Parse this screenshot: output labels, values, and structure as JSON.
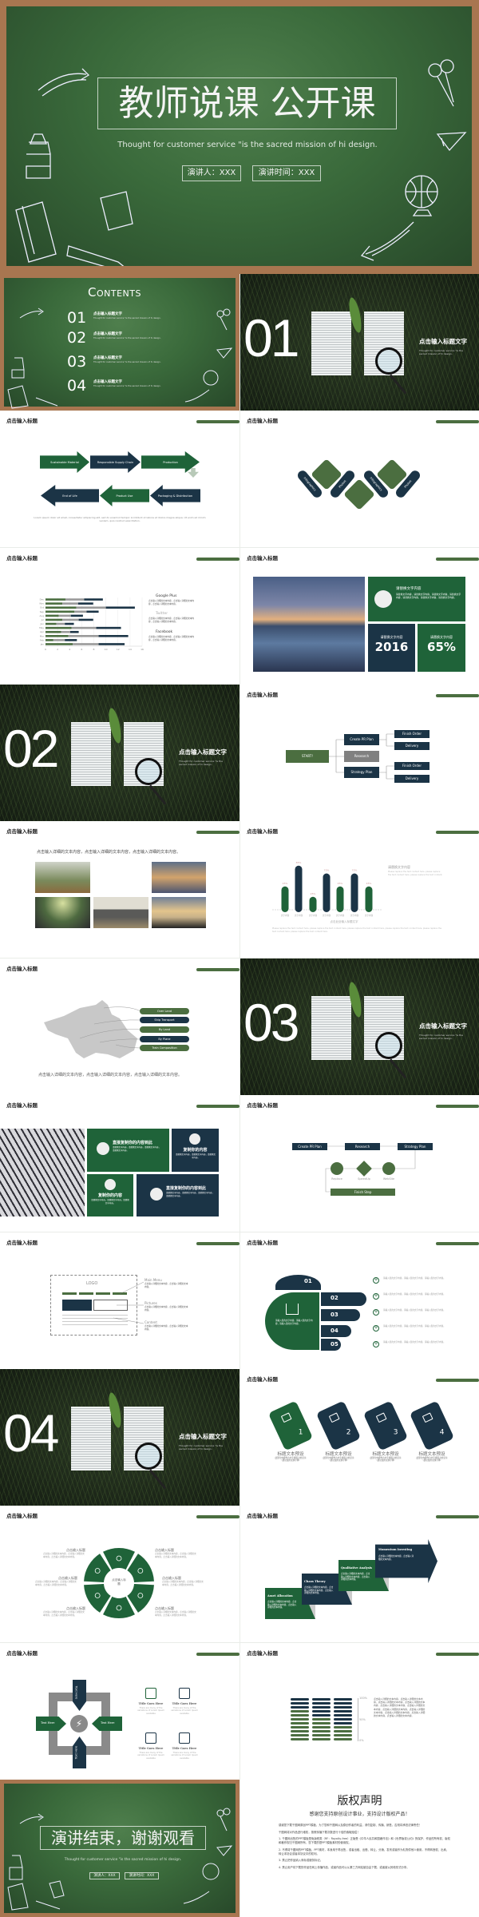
{
  "colors": {
    "green": "#1f6339",
    "olive": "#4b6e40",
    "navy": "#1b3446",
    "board": "#3a6a3b",
    "frame": "#a87650"
  },
  "main": {
    "title": "教师说课 公开课",
    "subtitle": "Thought for customer service \"is the sacred mission of hi design.",
    "speaker": "演讲人：XXX",
    "time": "演讲时间：XXX"
  },
  "slide_title": "点击输入标题",
  "contents": {
    "heading": "Contents",
    "items": [
      {
        "num": "01",
        "title": "点击输入标题文字",
        "desc": "Thought for customer service \"is the sacred mission of hi design."
      },
      {
        "num": "02",
        "title": "点击输入标题文字",
        "desc": "Thought for customer service \"is the sacred mission of hi design."
      },
      {
        "num": "03",
        "title": "点击输入标题文字",
        "desc": "Thought for customer service \"is the sacred mission of hi design."
      },
      {
        "num": "04",
        "title": "点击输入标题文字",
        "desc": "Thought for customer service \"is the sacred mission of hi design."
      }
    ]
  },
  "sections": [
    {
      "num": "01",
      "title": "点击输入标题文字",
      "desc": "Thought for customer service \"is the sacred mission of hi design."
    },
    {
      "num": "02",
      "title": "点击输入标题文字",
      "desc": "Thought for customer service \"is the sacred mission of hi design."
    },
    {
      "num": "03",
      "title": "点击输入标题文字",
      "desc": "Thought for customer service \"is the sacred mission of hi design."
    },
    {
      "num": "04",
      "title": "点击输入标题文字",
      "desc": "Thought for customer service \"is the sacred mission of hi design."
    }
  ],
  "process": {
    "top": [
      "Sustainable Material",
      "Responsible Supply Chain",
      "Production"
    ],
    "bottom": [
      "End of Life",
      "Product Use",
      "Packaging & Distribution"
    ],
    "desc": "Lorem ipsum dolor sit amet, consectetur adipiscing elit, sed do eiusmod tempor incididunt ut labore et dolore magna aliqua. Ut enim ad minim veniam, quis nostrud exercitation."
  },
  "diamonds": {
    "labels": [
      "Infographics",
      "Photos",
      "Infographics",
      "Photos"
    ]
  },
  "social": [
    {
      "name": "Google Plus",
      "body": "点击输入详细的文本内容，点击输入详细的文本内容，点击输入详细的文本内容。"
    },
    {
      "name": "Twitter",
      "body": "点击输入详细的文本内容，点击输入详细的文本内容，点击输入详细的文本内容。"
    },
    {
      "name": "Facebook",
      "body": "点击输入详细的文本内容，点击输入详细的文本内容，点击输入详细的文本内容。"
    }
  ],
  "stats": {
    "box_title": "请替换文字内容",
    "box_body": "请替换文字内容，请替换文字内容，请替换文字内容，请替换文字内容，请替换文字内容，请替换文字内容，请替换文字内容。",
    "year_label": "请替换文字内容",
    "year": "2016",
    "pct_label": "请替换文字内容",
    "pct": "65%"
  },
  "flow1": {
    "start": "START!",
    "mid": [
      "Create PR Plan",
      "Research",
      "Strategy Plan"
    ],
    "leaves": [
      "Finish Order",
      "Delivery",
      "Finish Order",
      "Delivery"
    ]
  },
  "gallery": {
    "caption": "点击输入详细的文本内容，点击输入详细的文本内容，点击输入详细的文本内容。"
  },
  "column_side": {
    "title": "请替换文字内容",
    "body": "Please replace the text content here, please replace the text content here, please replace the text content.",
    "caption": "点击此处输入标题文字",
    "note": "Please replace the text content here, please replace the text content here, please replace the text content here, please replace the text content here, please replace the text content here, please replace the text content here."
  },
  "map": {
    "routes": [
      "Over Land",
      "Ship Transport",
      "By Land",
      "By Plane",
      "Train Composition"
    ],
    "caption": "点击输入详细的文本内容，点击输入详细的文本内容，点击输入详细的文本内容。"
  },
  "tiles": [
    {
      "title": "直接复制你的内容到此",
      "body": "请替换文字内容，请替换文字内容，请替换文字内容，请替换文字内容。"
    },
    {
      "title": "复制你的内容",
      "body": "请替换文字内容，请替换文字内容，请替换文字内容。"
    },
    {
      "title": "复制你的内容",
      "body": "请替换文字内容，请替换文字内容，请替换文字内容。"
    },
    {
      "title": "直接复制你的内容到此",
      "body": "请替换文字内容，请替换文字内容，请替换文字内容，请替换文字内容。"
    }
  ],
  "flow2": {
    "steps": [
      "Create PR Plan",
      "Research",
      "Strategy Plan"
    ],
    "nodes": [
      "Replace",
      "SpeedUp",
      "WebSite"
    ],
    "finish": "Finish Step"
  },
  "wireframe": {
    "logo": "LOGO",
    "labels": [
      {
        "title": "Main Menu",
        "body": "点击输入详细的文本内容，点击输入详细的文本内容。"
      },
      {
        "title": "Pictures",
        "body": "点击输入详细的文本内容，点击输入详细的文本内容。"
      },
      {
        "title": "Content",
        "body": "点击输入详细的文本内容，点击输入详细的文本内容。"
      }
    ]
  },
  "hand": {
    "fingers": [
      "01",
      "02",
      "03",
      "04",
      "05"
    ],
    "palm_text": "请输入您的文字内容，请输入您的文字内容，请输入您的文字内容。",
    "items": [
      "请输入您的文字内容，请输入您的文字内容，请输入您的文字内容。",
      "请输入您的文字内容，请输入您的文字内容，请输入您的文字内容。",
      "请输入您的文字内容，请输入您的文字内容，请输入您的文字内容。",
      "请输入您的文字内容，请输入您的文字内容，请输入您的文字内容。",
      "请输入您的文字内容，请输入您的文字内容，请输入您的文字内容。"
    ]
  },
  "cards": [
    {
      "num": "1",
      "title": "标题文本预设",
      "body": "此部分内容作为文字排版占位显示（建议使用主题字体）"
    },
    {
      "num": "2",
      "title": "标题文本预设",
      "body": "此部分内容作为文字排版占位显示（建议使用主题字体）"
    },
    {
      "num": "3",
      "title": "标题文本预设",
      "body": "此部分内容作为文字排版占位显示（建议使用主题字体）"
    },
    {
      "num": "4",
      "title": "标题文本预设",
      "body": "此部分内容作为文字排版占位显示（建议使用主题字体）"
    }
  ],
  "cycle": {
    "center": "点击输入标题",
    "items": [
      {
        "title": "点击输入标题",
        "body": "点击输入详细的文本内容，点击输入详细的文本内容，点击输入详细的文本内容。"
      },
      {
        "title": "点击输入标题",
        "body": "点击输入详细的文本内容，点击输入详细的文本内容，点击输入详细的文本内容。"
      },
      {
        "title": "点击输入标题",
        "body": "点击输入详细的文本内容，点击输入详细的文本内容，点击输入详细的文本内容。"
      },
      {
        "title": "点击输入标题",
        "body": "点击输入详细的文本内容，点击输入详细的文本内容，点击输入详细的文本内容。"
      },
      {
        "title": "点击输入标题",
        "body": "点击输入详细的文本内容，点击输入详细的文本内容，点击输入详细的文本内容。"
      },
      {
        "title": "点击输入标题",
        "body": "点击输入详细的文本内容，点击输入详细的文本内容，点击输入详细的文本内容。"
      }
    ]
  },
  "stairs": [
    {
      "title": "Asset Allocation",
      "body": "点击输入详细的文本内容，点击输入详细的文本内容，点击输入详细的文本内容。"
    },
    {
      "title": "Chaos Theory",
      "body": "点击输入详细的文本内容，点击输入详细的文本内容，点击输入详细的文本内容。"
    },
    {
      "title": "Qualitative Analysis",
      "body": "点击输入详细的文本内容，点击输入详细的文本内容，点击输入详细的文本内容。"
    },
    {
      "title": "Momentum Investing",
      "body": "点击输入详细的文本内容，点击输入详细的文本内容。"
    }
  ],
  "cross": {
    "arrows": [
      "Text Here",
      "Text Here",
      "Text Here",
      "Text Here"
    ],
    "features": [
      {
        "icon": "document-icon",
        "title": "Title Goes Here",
        "body": "There are many of the variations of Lorem Ipsum available"
      },
      {
        "icon": "line-chart-icon",
        "title": "Title Goes Here",
        "body": "There are many of the variations of Lorem Ipsum available"
      },
      {
        "icon": "calendar-icon",
        "title": "Title Goes Here",
        "body": "There are many of the variations of Lorem Ipsum available"
      },
      {
        "icon": "laptop-icon",
        "title": "Title Goes Here",
        "body": "There are many of the variations of Lorem Ipsum available"
      }
    ]
  },
  "pill_grid": {
    "ticks": [
      "100%",
      "50%",
      "0%"
    ],
    "rows": 11,
    "dark_counts": [
      3,
      5,
      7
    ],
    "body": "点击输入详细的文本内容，点击输入详细的文本内容，点击输入详细的文本内容，点击输入详细的文本内容，点击输入详细的文本内容，点击输入详细的文本内容，点击输入详细的文本内容，点击输入详细的文本内容，点击输入详细的文本内容，点击输入详细的文本内容，点击输入详细的文本内容。"
  },
  "ending": {
    "title": "演讲结束，谢谢观看",
    "subtitle": "Thought for customer service \"is the sacred mission of hi design.",
    "speaker": "演讲人：XXX",
    "time": "演讲时间：XXX"
  },
  "copyright": {
    "title": "版权声明",
    "subtitle": "感谢您支持原创设计事业，支持设计版权产品！",
    "paragraphs": [
      "感谢您下载千图网原创PPT模板，为了您和千图网以及原创作者的利益，请勿复制、传播、销售，否则将承担法律责任！",
      "千图网将对作品进行维权，按照传播下载次数进行十倍的索取赔偿！",
      "1. 千图网出售的PPT模板是免版税类（RF：Royalty-free）正版受《中华人民共和国著作法》和《世界版权公约》的保护，作品的所有权、版权和著作权归千图网所有，您下载的是PPT模板素材的使用权。",
      "2. 不得将千图网的PPT模板、PPT素材，本身用于再出售，或者出租、出借、转让、分销、发布或者作为礼物供他人使用，不得转授权、出卖、转让本协议或者本协议中的权利。",
      "3. 禁止把作品纳入商标或服务标记。",
      "4. 禁止用户将下载的作品在网上传播作品，或者作品可以从第三方网站被自由下载，或者被以其他形式分享。"
    ]
  },
  "chart_data": [
    {
      "type": "bar",
      "orientation": "horizontal",
      "stacked": true,
      "categories": [
        "Dec",
        "Nov",
        "Oct",
        "Sep",
        "Aug",
        "Jul",
        "Jun",
        "May",
        "Apr",
        "Mar",
        "Feb",
        "Jan"
      ],
      "xticks": [
        "0",
        "2",
        "4",
        "6",
        "8",
        "10",
        "12",
        "14",
        "16"
      ],
      "xlim": [
        0,
        16
      ],
      "grid": true,
      "series": [
        {
          "values": [
            3.3,
            2.8,
            5.1,
            4.8,
            2.2,
            2.8,
            1.8,
            4.3,
            2.6,
            3.8,
            1.3,
            4.5
          ],
          "color": "#4b6e40"
        },
        {
          "values": [
            3.1,
            2.6,
            4.9,
            2.0,
            2.0,
            2.7,
            1.4,
            4.1,
            1.5,
            5.0,
            1.9,
            4.3
          ],
          "color": "#9a9a9a"
        },
        {
          "values": [
            3.1,
            2.5,
            4.8,
            2.0,
            2.0,
            2.4,
            1.5,
            4.1,
            1.4,
            4.9,
            2.0,
            4.3
          ],
          "color": "#1b3446"
        }
      ]
    },
    {
      "type": "bar",
      "categories": [
        "文字内容",
        "文字内容",
        "文字内容",
        "文字内容",
        "文字内容",
        "文字内容",
        "文字内容"
      ],
      "values": [
        45,
        85,
        25,
        70,
        45,
        70,
        45
      ],
      "labels": [
        "45%",
        "85%",
        "25%",
        "70%",
        "45%",
        "70%",
        "45%"
      ],
      "colors": [
        "#1f6339",
        "#1b3446",
        "#1f6339",
        "#1b3446",
        "#1f6339",
        "#1b3446",
        "#1f6339"
      ],
      "ylim": [
        0,
        100
      ],
      "xlabel": "点击此处输入标题文字"
    }
  ]
}
